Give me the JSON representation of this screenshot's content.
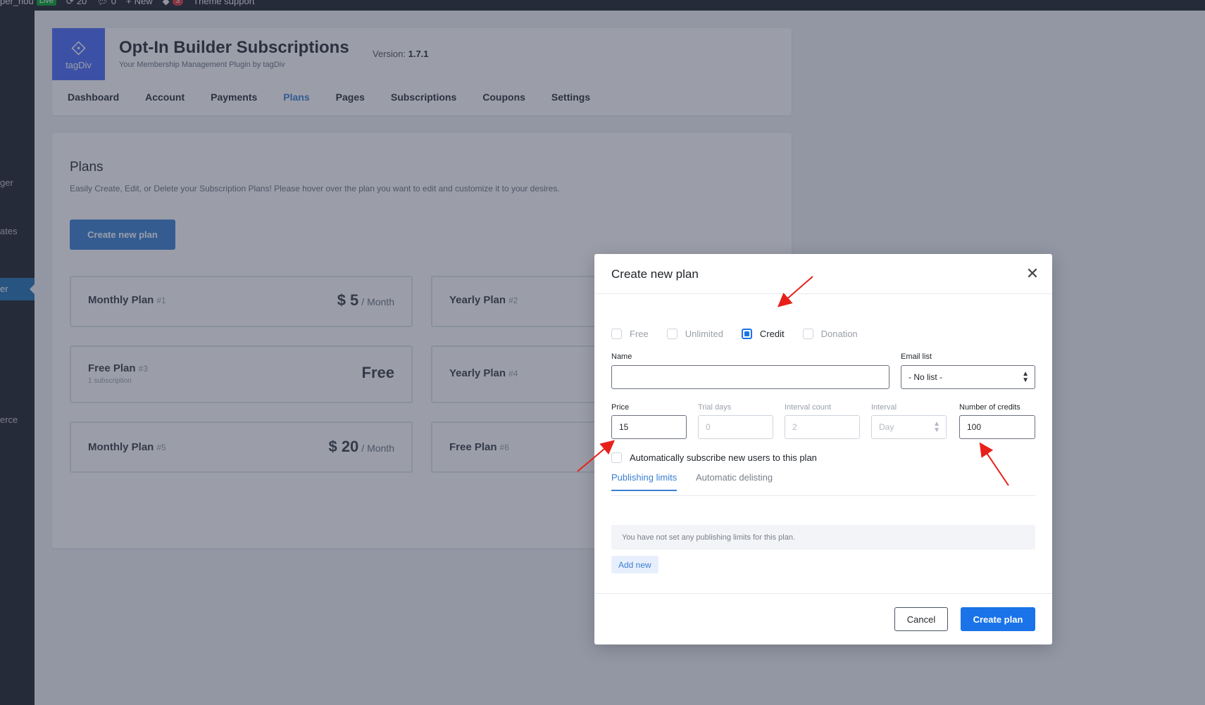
{
  "admin_bar": {
    "site_name": "per_nou",
    "live_badge": "Live",
    "updates_count": "20",
    "comments_count": "0",
    "new_label": "New",
    "notif_count": "3",
    "theme_support": "Theme support"
  },
  "sidebar": {
    "items": [
      {
        "label": "ger"
      },
      {
        "label": "ates"
      },
      {
        "label": "er"
      },
      {
        "label": "erce"
      }
    ]
  },
  "plugin": {
    "logo_text": "tagDiv",
    "title": "Opt-In Builder Subscriptions",
    "subtitle": "Your Membership Management Plugin by tagDiv",
    "version_label": "Version:",
    "version": "1.7.1",
    "nav": [
      "Dashboard",
      "Account",
      "Payments",
      "Plans",
      "Pages",
      "Subscriptions",
      "Coupons",
      "Settings"
    ],
    "active_nav": "Plans"
  },
  "plans_page": {
    "title": "Plans",
    "description": "Easily Create, Edit, or Delete your Subscription Plans! Please hover over the plan you want to edit and customize it to your desires.",
    "create_button": "Create new plan",
    "plans": [
      {
        "name": "Monthly Plan",
        "num": "#1",
        "price": "$ 5",
        "period": "/ Month",
        "sub": ""
      },
      {
        "name": "Yearly Plan",
        "num": "#2",
        "price": "",
        "period": "",
        "sub": ""
      },
      {
        "name": "Free Plan",
        "num": "#3",
        "price": "Free",
        "period": "",
        "sub": "1 subscription"
      },
      {
        "name": "Yearly Plan",
        "num": "#4",
        "price": "",
        "period": "",
        "sub": ""
      },
      {
        "name": "Monthly Plan",
        "num": "#5",
        "price": "$ 20",
        "period": "/ Month",
        "sub": ""
      },
      {
        "name": "Free Plan",
        "num": "#6",
        "price": "",
        "period": "",
        "sub": ""
      }
    ]
  },
  "modal": {
    "title": "Create new plan",
    "close_icon": "close-icon",
    "plan_types": [
      {
        "label": "Free",
        "checked": false
      },
      {
        "label": "Unlimited",
        "checked": false
      },
      {
        "label": "Credit",
        "checked": true
      },
      {
        "label": "Donation",
        "checked": false
      }
    ],
    "fields": {
      "name_label": "Name",
      "name_value": "",
      "email_list_label": "Email list",
      "email_list_value": "- No list -",
      "price_label": "Price",
      "price_value": "15",
      "trial_days_label": "Trial days",
      "trial_days_value": "0",
      "interval_count_label": "Interval count",
      "interval_count_value": "2",
      "interval_label": "Interval",
      "interval_value": "Day",
      "credits_label": "Number of credits",
      "credits_value": "100"
    },
    "auto_subscribe_label": "Automatically subscribe new users to this plan",
    "tabs": [
      "Publishing limits",
      "Automatic delisting"
    ],
    "active_tab": "Publishing limits",
    "limits_empty": "You have not set any publishing limits for this plan.",
    "add_new": "Add new",
    "cancel": "Cancel",
    "create": "Create plan"
  },
  "colors": {
    "accent": "#1a73e8",
    "nav_active": "#3a80d2",
    "annotation": "#e8201a"
  }
}
